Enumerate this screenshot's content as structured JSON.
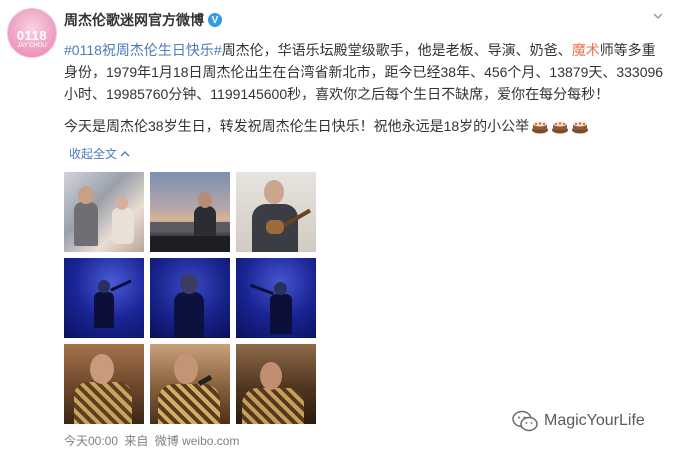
{
  "header": {
    "avatar_main": "0118",
    "avatar_sub": "JAY CHOU",
    "name": "周杰伦歌迷网官方微博",
    "verified_mark": "V",
    "more_icon": "chevron-down-icon"
  },
  "post": {
    "topic": "#0118祝周杰伦生日快乐#",
    "seg1": "周杰伦，华语乐坛殿堂级歌手，他是老板、导演、奶爸、",
    "link": "魔术",
    "seg2": "师等多重身份，1979年1月18日周杰伦出生在台湾省新北市，距今已经38年、456个月、13879天、333096小时、19985760分钟、1199145600秒，喜欢你之后每个生日不缺席，爱你在每分每秒！",
    "line2": "今天是周杰伦38岁生日，转发祝周杰伦生日快乐！祝他永远是18岁的小公举",
    "collapse": "收起全文",
    "collapse_icon": "chevron-up-icon",
    "emoji": "cake-icon"
  },
  "photos": [
    {
      "name": "photo-stage-1",
      "tone": "bright-stage"
    },
    {
      "name": "photo-boat",
      "tone": "sunset-canal"
    },
    {
      "name": "photo-guitar",
      "tone": "ukulele-indoor"
    },
    {
      "name": "photo-concert-blue-1",
      "tone": "blue-stage"
    },
    {
      "name": "photo-concert-blue-2",
      "tone": "blue-stage"
    },
    {
      "name": "photo-concert-blue-3",
      "tone": "blue-stage"
    },
    {
      "name": "photo-concert-gold-1",
      "tone": "gold-jacket"
    },
    {
      "name": "photo-concert-gold-2",
      "tone": "gold-jacket"
    },
    {
      "name": "photo-concert-gold-3",
      "tone": "gold-jacket"
    }
  ],
  "footer": {
    "time": "今天00:00",
    "from": "来自",
    "source": "微博 weibo.com"
  },
  "watermark": {
    "text": "MagicYourLife",
    "icon": "wechat-icon"
  },
  "colors": {
    "link": "#eb7350",
    "topic": "#4b7bbb",
    "verified": "#2e9be6"
  }
}
